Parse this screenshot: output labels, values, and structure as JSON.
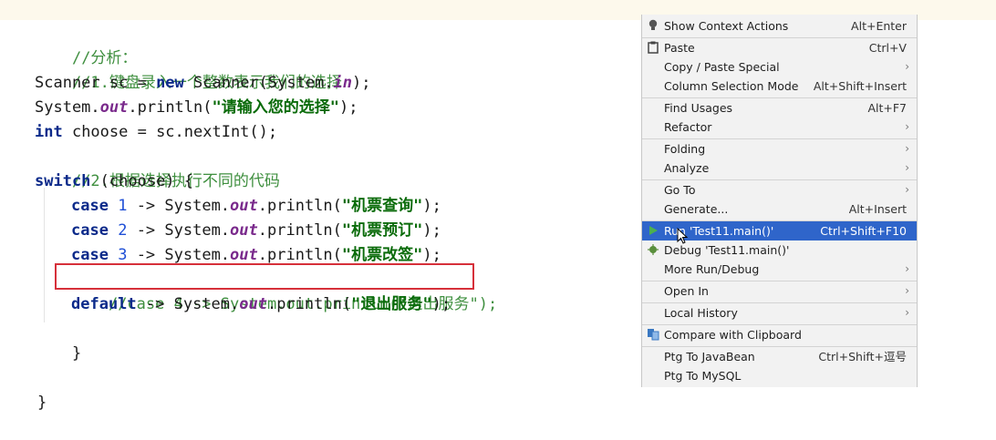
{
  "editor": {
    "lines": [
      {
        "parts": [
          "//分析："
        ]
      },
      {
        "parts": [
          "//1.键盘录入一个整数表示我们的选择"
        ]
      },
      {
        "parts": [
          "Scanner sc = ",
          "new",
          " Scanner(System.",
          "in",
          ");"
        ]
      },
      {
        "parts": [
          "System.",
          "out",
          ".println(",
          "\"请输入您的选择\"",
          ");"
        ]
      },
      {
        "parts": [
          "int",
          " choose = sc.nextInt();"
        ]
      },
      {
        "parts": [
          "//2.根据选择执行不同的代码"
        ]
      },
      {
        "parts": [
          "switch",
          " (choose) {"
        ]
      },
      {
        "parts": [
          "case",
          " ",
          "1",
          " -> System.",
          "out",
          ".println(",
          "\"机票查询\"",
          ");"
        ]
      },
      {
        "parts": [
          "case",
          " ",
          "2",
          " -> System.",
          "out",
          ".println(",
          "\"机票预订\"",
          ");"
        ]
      },
      {
        "parts": [
          "case",
          " ",
          "3",
          " -> System.",
          "out",
          ".println(",
          "\"机票改签\"",
          ");"
        ]
      },
      {
        "parts": [
          "//case 4 -> System.out.println(\"退出服务\");"
        ]
      },
      {
        "parts": [
          "default",
          " -> System.",
          "out",
          ".println(",
          "\"退出服务\"",
          ");"
        ]
      },
      {
        "parts": [
          "}"
        ]
      },
      {
        "parts": [
          "}"
        ]
      }
    ]
  },
  "context_menu": {
    "items": [
      {
        "label": "Show Context Actions",
        "shortcut": "Alt+Enter",
        "icon": "lightbulb-icon"
      },
      {
        "label": "Paste",
        "shortcut": "Ctrl+V",
        "icon": "clipboard-icon"
      },
      {
        "label": "Copy / Paste Special",
        "shortcut": "",
        "submenu": "›"
      },
      {
        "label": "Column Selection Mode",
        "shortcut": "Alt+Shift+Insert"
      },
      {
        "label": "Find Usages",
        "shortcut": "Alt+F7"
      },
      {
        "label": "Refactor",
        "shortcut": "",
        "submenu": "›"
      },
      {
        "label": "Folding",
        "shortcut": "",
        "submenu": "›"
      },
      {
        "label": "Analyze",
        "shortcut": "",
        "submenu": "›"
      },
      {
        "label": "Go To",
        "shortcut": "",
        "submenu": "›"
      },
      {
        "label": "Generate...",
        "shortcut": "Alt+Insert"
      },
      {
        "label": "Run 'Test11.main()'",
        "shortcut": "Ctrl+Shift+F10",
        "icon": "run-icon"
      },
      {
        "label": "Debug 'Test11.main()'",
        "shortcut": "",
        "icon": "debug-icon"
      },
      {
        "label": "More Run/Debug",
        "shortcut": "",
        "submenu": "›"
      },
      {
        "label": "Open In",
        "shortcut": "",
        "submenu": "›"
      },
      {
        "label": "Local History",
        "shortcut": "",
        "submenu": "›"
      },
      {
        "label": "Compare with Clipboard",
        "shortcut": "",
        "icon": "compare-icon"
      },
      {
        "label": "Ptg To JavaBean",
        "shortcut": "Ctrl+Shift+逗号"
      },
      {
        "label": "Ptg To MySQL",
        "shortcut": ""
      }
    ]
  },
  "colors": {
    "selection": "#2f65ca",
    "highlight_box": "#d6303a",
    "keyword": "#0b2a8a",
    "comment": "#3f8f3f",
    "string": "#0a6b0a"
  }
}
